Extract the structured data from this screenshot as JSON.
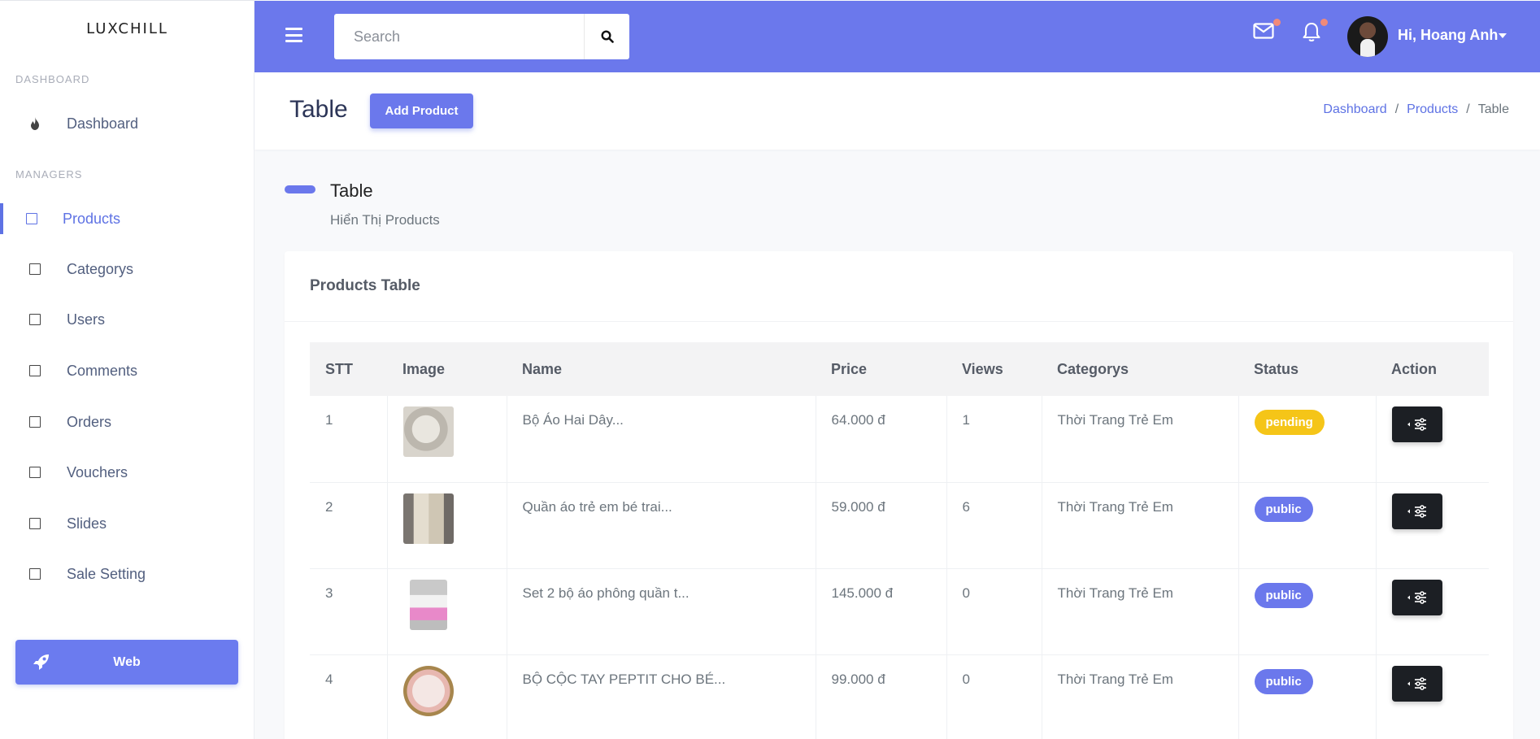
{
  "brand": "LUXCHILL",
  "sidebar": {
    "sections": [
      {
        "title": "DASHBOARD"
      },
      {
        "title": "MANAGERS"
      }
    ],
    "dashboard_label": "Dashboard",
    "items": [
      {
        "label": "Products",
        "active": true
      },
      {
        "label": "Categorys"
      },
      {
        "label": "Users"
      },
      {
        "label": "Comments"
      },
      {
        "label": "Orders"
      },
      {
        "label": "Vouchers"
      },
      {
        "label": "Slides"
      },
      {
        "label": "Sale Setting"
      }
    ],
    "web_button": "Web"
  },
  "topbar": {
    "search_placeholder": "Search",
    "greeting": "Hi, Hoang Anh"
  },
  "header": {
    "title": "Table",
    "add_button": "Add Product",
    "breadcrumb": [
      "Dashboard",
      "Products",
      "Table"
    ]
  },
  "section": {
    "title": "Table",
    "subtitle": "Hiển Thị Products"
  },
  "card": {
    "title": "Products Table",
    "columns": [
      "STT",
      "Image",
      "Name",
      "Price",
      "Views",
      "Categorys",
      "Status",
      "Action"
    ],
    "rows": [
      {
        "stt": "1",
        "name": "Bộ Áo Hai Dây...",
        "price": "64.000 đ",
        "views": "1",
        "category": "Thời Trang Trẻ Em",
        "status": "pending"
      },
      {
        "stt": "2",
        "name": "Quần áo trẻ em bé trai...",
        "price": "59.000 đ",
        "views": "6",
        "category": "Thời Trang Trẻ Em",
        "status": "public"
      },
      {
        "stt": "3",
        "name": "Set 2 bộ áo phông quần t...",
        "price": "145.000 đ",
        "views": "0",
        "category": "Thời Trang Trẻ Em",
        "status": "public"
      },
      {
        "stt": "4",
        "name": "BỘ CỘC TAY PEPTIT CHO BÉ...",
        "price": "99.000 đ",
        "views": "0",
        "category": "Thời Trang Trẻ Em",
        "status": "public"
      }
    ]
  },
  "colors": {
    "primary": "#6b78ec",
    "pending": "#f5c518",
    "public": "#6b78ec",
    "action": "#1c1f24"
  }
}
